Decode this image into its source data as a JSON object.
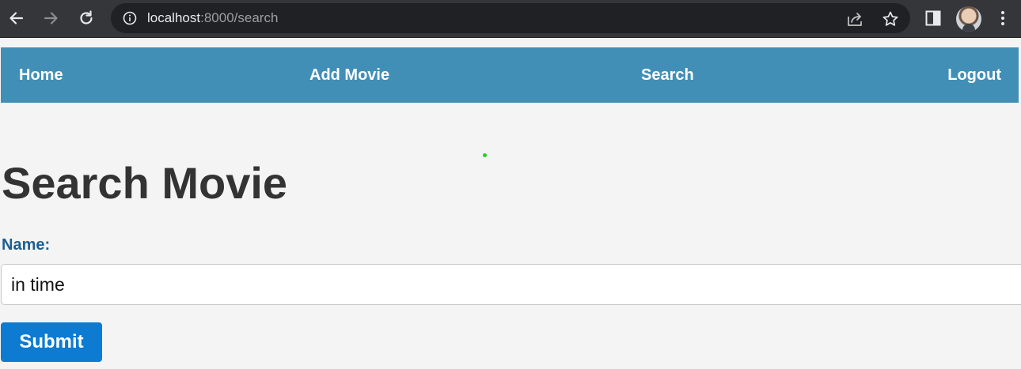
{
  "browser": {
    "url_host": "localhost",
    "url_rest": ":8000/search",
    "icons": {
      "back": "back-arrow-icon",
      "forward": "forward-arrow-icon",
      "reload": "reload-icon",
      "info": "info-icon",
      "share": "share-icon",
      "bookmark": "star-icon",
      "side_panel": "side-panel-icon",
      "menu": "kebab-menu-icon"
    }
  },
  "navbar": {
    "background": "#418fb6",
    "items": [
      {
        "label": "Home"
      },
      {
        "label": "Add Movie"
      },
      {
        "label": "Search"
      },
      {
        "label": "Logout"
      }
    ]
  },
  "main": {
    "title": "Search Movie",
    "form": {
      "name_label": "Name:",
      "name_value": "in time",
      "submit_label": "Submit",
      "submit_color": "#0c7bd1"
    }
  }
}
